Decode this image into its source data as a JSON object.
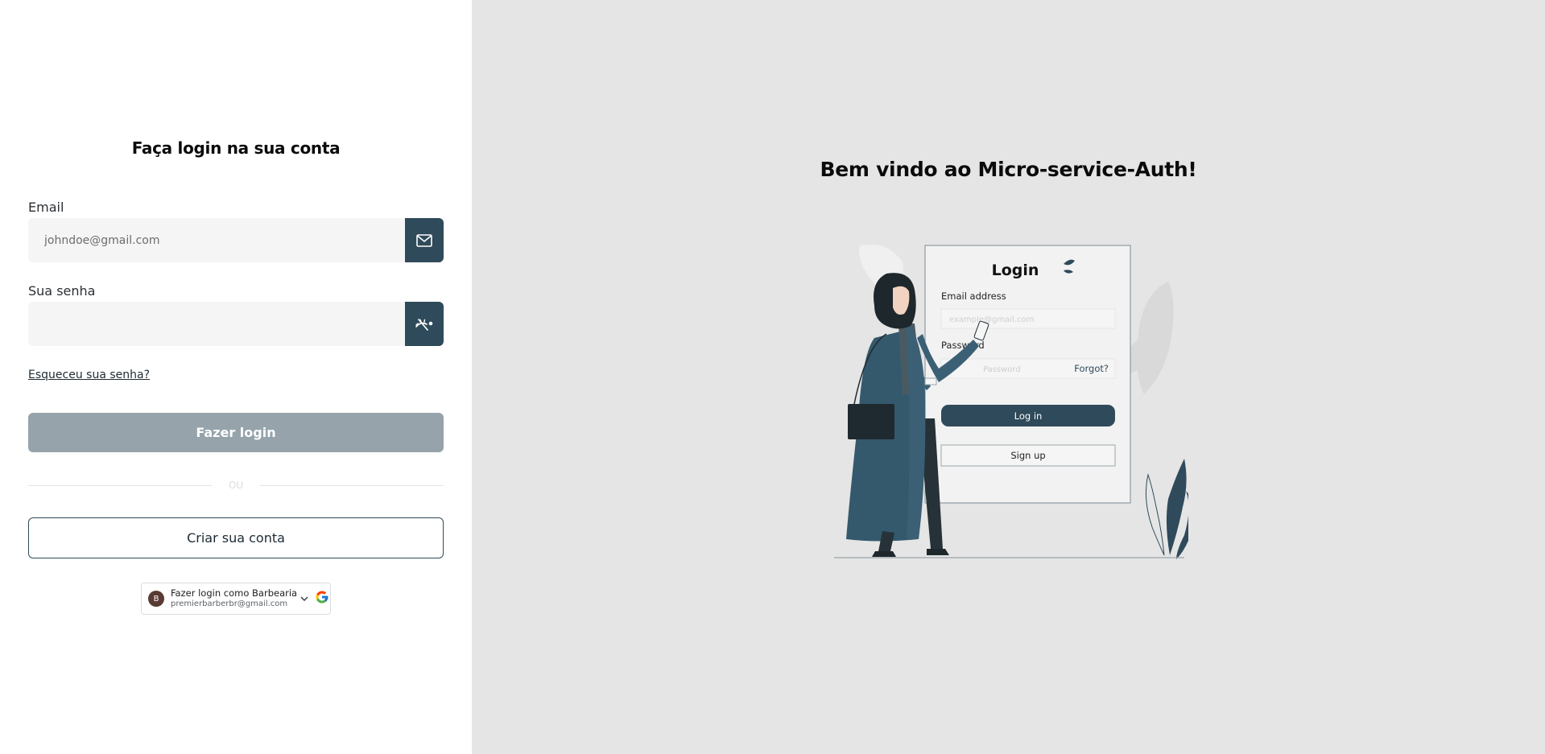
{
  "login_form": {
    "title": "Faça login na sua conta",
    "email_label": "Email",
    "email_placeholder": "johndoe@gmail.com",
    "email_value": "",
    "password_label": "Sua senha",
    "password_value": "",
    "forgot_link": "Esqueceu sua senha?",
    "login_button": "Fazer login",
    "divider_text": "OU",
    "create_account_button": "Criar sua conta"
  },
  "google_signin": {
    "avatar_initial": "B",
    "label": "Fazer login como Barbearia",
    "email": "premierbarberbr@gmail.com",
    "icon": "google-logo"
  },
  "welcome": {
    "title": "Bem vindo ao Micro-service-Auth!"
  },
  "illustration": {
    "card_title": "Login",
    "email_label": "Email address",
    "email_placeholder": "example@gmail.com",
    "password_label": "Password",
    "password_placeholder": "Password",
    "forgot": "Forgot?",
    "login_button": "Log in",
    "signup_button": "Sign up"
  },
  "icons": {
    "email_button": "mail-icon",
    "password_button": "eye-off-icon"
  },
  "colors": {
    "accent": "#2f4a5a",
    "login_button_disabled": "#96a3ab",
    "right_panel_bg": "#e5e5e5",
    "input_bg": "#f5f5f5"
  }
}
